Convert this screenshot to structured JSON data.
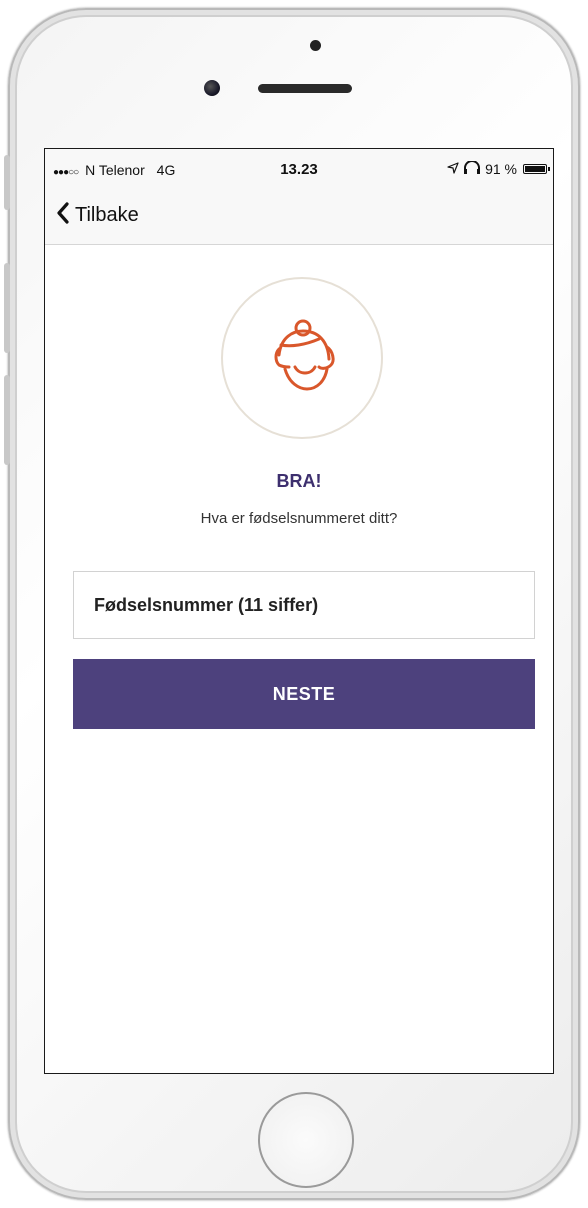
{
  "status_bar": {
    "signal": "●●●○○",
    "carrier": "N Telenor",
    "network": "4G",
    "time": "13.23",
    "battery_text": "91 %",
    "battery_level": 0.91,
    "icons": [
      "location-arrow-icon",
      "headphones-icon",
      "battery-icon"
    ]
  },
  "nav": {
    "back_label": "Tilbake",
    "back_icon": "chevron-left-icon"
  },
  "avatar": {
    "icon": "child-face-icon",
    "stroke_color": "#d9572b",
    "ring_color": "#e6e0d6"
  },
  "main": {
    "headline": "BRA!",
    "question": "Hva er fødselsnummeret ditt?",
    "input_placeholder": "Fødselsnummer (11 siffer)",
    "input_value": "",
    "next_label": "NESTE"
  },
  "colors": {
    "primary": "#4d417d",
    "headline": "#3d2f6e",
    "accent": "#d9572b"
  }
}
